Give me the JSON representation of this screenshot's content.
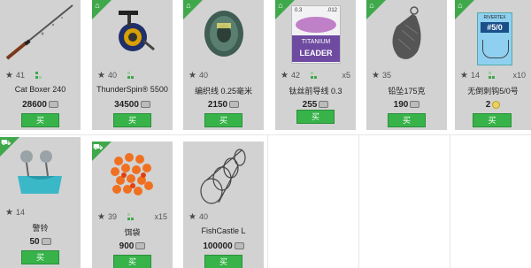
{
  "buy_label": "买",
  "colors": {
    "accent": "#37b34a",
    "card": "#d2d2d2"
  },
  "items": [
    {
      "name": "Cat Boxer 240",
      "rating": "41",
      "price": "28600",
      "qty": "",
      "corner": false,
      "corner_icon": "",
      "icon": "fishing-rod"
    },
    {
      "name": "ThunderSpin® 5500",
      "rating": "40",
      "price": "34500",
      "qty": "",
      "corner": true,
      "corner_icon": "home-icon",
      "icon": "spinning-reel"
    },
    {
      "name": "编织线 0.25毫米",
      "rating": "40",
      "price": "2150",
      "qty": "",
      "corner": true,
      "corner_icon": "home-icon",
      "icon": "braided-line-spool"
    },
    {
      "name": "钛丝前导线 0.3",
      "rating": "42",
      "price": "255",
      "qty": "x5",
      "corner": true,
      "corner_icon": "home-icon",
      "icon": "titanium-leader-pack",
      "pack_text": [
        "0.3",
        ".012",
        "TITANIUM",
        "LEADER"
      ]
    },
    {
      "name": "铅坠175克",
      "rating": "35",
      "price": "190",
      "qty": "",
      "corner": true,
      "corner_icon": "home-icon",
      "icon": "lead-sinker"
    },
    {
      "name": "无倒刺钩5/0号",
      "rating": "14",
      "price": "2",
      "qty": "x10",
      "corner": true,
      "corner_icon": "home-icon",
      "icon": "hook-pack",
      "pack_text": [
        "RIVERTEX",
        "#5/0"
      ]
    },
    {
      "name": "警铃",
      "rating": "14",
      "price": "50",
      "qty": "",
      "corner": true,
      "corner_icon": "car-icon",
      "icon": "bite-alarm-bells"
    },
    {
      "name": "饵袋",
      "rating": "39",
      "price": "900",
      "qty": "x15",
      "corner": true,
      "corner_icon": "car-icon",
      "icon": "bait-pellets"
    },
    {
      "name": "FishCastle L",
      "rating": "40",
      "price": "100000",
      "qty": "",
      "corner": false,
      "corner_icon": "",
      "icon": "keep-net"
    }
  ]
}
